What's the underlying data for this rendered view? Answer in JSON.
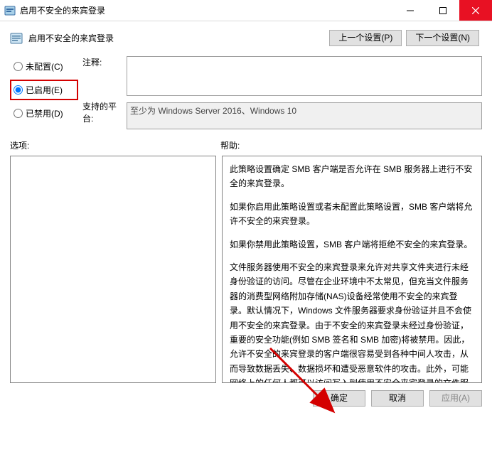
{
  "window": {
    "title": "启用不安全的来宾登录",
    "min_tip": "Minimize",
    "max_tip": "Maximize",
    "close_tip": "Close"
  },
  "header": {
    "policy_title": "启用不安全的来宾登录",
    "prev_btn": "上一个设置(P)",
    "next_btn": "下一个设置(N)"
  },
  "radios": {
    "not_configured": "未配置(C)",
    "enabled": "已启用(E)",
    "disabled": "已禁用(D)",
    "selected": "enabled"
  },
  "labels": {
    "comment": "注释:",
    "platform": "支持的平台:",
    "options": "选项:",
    "help": "帮助:"
  },
  "fields": {
    "comment_value": "",
    "platform_value": "至少为 Windows Server 2016、Windows 10"
  },
  "help_paragraphs": [
    "此策略设置确定 SMB 客户端是否允许在 SMB 服务器上进行不安全的来宾登录。",
    "如果你启用此策略设置或者未配置此策略设置，SMB 客户端将允许不安全的来宾登录。",
    "如果你禁用此策略设置，SMB 客户端将拒绝不安全的来宾登录。",
    "文件服务器使用不安全的来宾登录来允许对共享文件夹进行未经身份验证的访问。尽管在企业环境中不太常见，但充当文件服务器的消费型网络附加存储(NAS)设备经常使用不安全的来宾登录。默认情况下，Windows 文件服务器要求身份验证并且不会使用不安全的来宾登录。由于不安全的来宾登录未经过身份验证，重要的安全功能(例如 SMB 签名和 SMB 加密)将被禁用。因此，允许不安全的来宾登录的客户端很容易受到各种中间人攻击，从而导致数据丢失、数据损坏和遭受恶意软件的攻击。此外，可能网络上的任何人都可以访问写入到使用不安全来宾登录的文件服务器中的任何数据。Microsoft 建议禁用不安全的来宾登录，并将文件服务器配置为要求经过身份验证的访问"
  ],
  "footer": {
    "ok": "确定",
    "cancel": "取消",
    "apply": "应用(A)"
  }
}
